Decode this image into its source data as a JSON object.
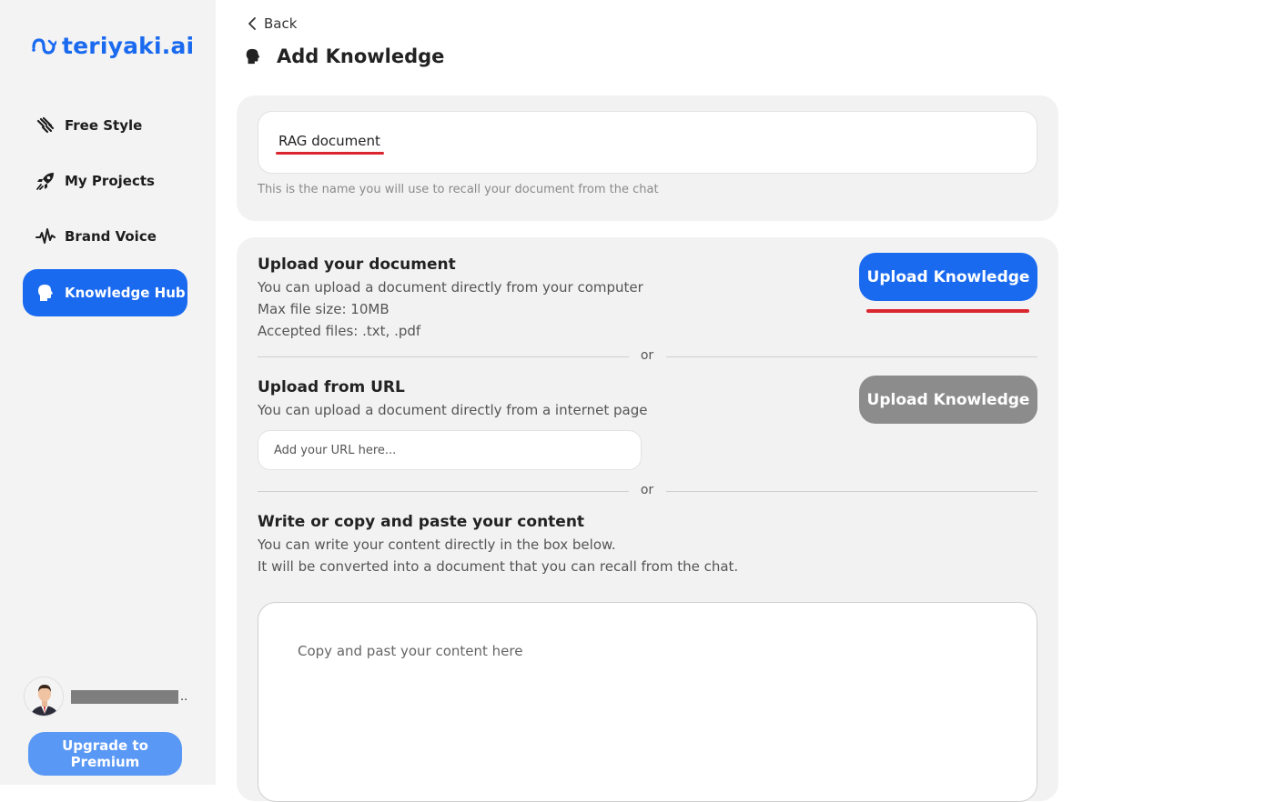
{
  "app": {
    "logo_text": "teriyaki.ai",
    "brand_color": "#1a6af0"
  },
  "sidebar": {
    "items": [
      {
        "label": "Free Style",
        "icon": "free-style-icon"
      },
      {
        "label": "My Projects",
        "icon": "rocket-icon"
      },
      {
        "label": "Brand Voice",
        "icon": "waveform-icon"
      },
      {
        "label": "Knowledge Hub",
        "icon": "head-icon",
        "active": true
      }
    ],
    "user_ellipsis": "..",
    "upgrade_label": "Upgrade to Premium"
  },
  "header": {
    "back_label": "Back",
    "title": "Add Knowledge"
  },
  "name_section": {
    "value": "RAG document",
    "helper": "This is the name you will use to recall your document from the chat"
  },
  "upload_document": {
    "title": "Upload your document",
    "lines": [
      "You can upload a document directly from your computer",
      "Max file size: 10MB",
      "Accepted files: .txt, .pdf"
    ],
    "button_label": "Upload Knowledge"
  },
  "divider_label": "or",
  "upload_url": {
    "title": "Upload from URL",
    "description": "You can upload a document directly from a internet page",
    "placeholder": "Add your URL here...",
    "button_label": "Upload Knowledge"
  },
  "write_content": {
    "title": "Write or copy and paste your content",
    "lines": [
      "You can write your content directly in the box below.",
      "It will be converted into a document that you can recall from the chat."
    ],
    "placeholder": "Copy and past your content here"
  }
}
